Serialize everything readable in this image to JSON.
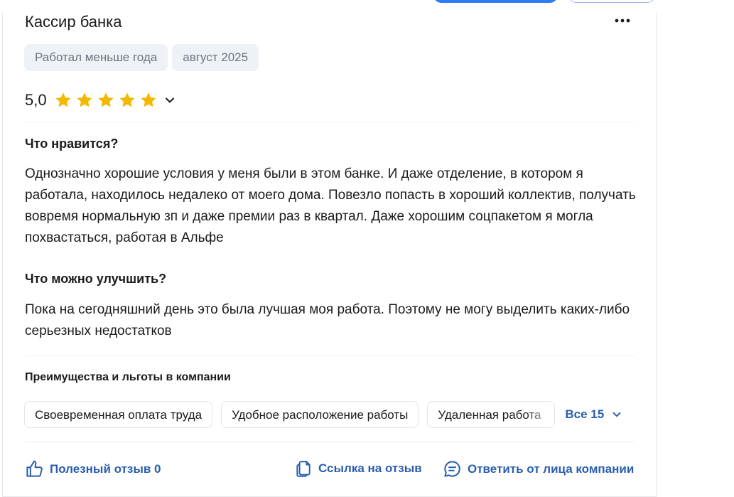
{
  "review": {
    "title": "Кассир банка",
    "tags": [
      "Работал меньше года",
      "август 2025"
    ],
    "rating": "5,0",
    "stars": 5,
    "likes_heading": "Что нравится?",
    "likes_text": "Однозначно хорошие условия у меня были в этом банке. И даже отделение, в котором я работала, находилось недалеко от моего дома. Повезло попасть в хороший коллектив, получать вовремя нормальную зп и даже премии раз в квартал. Даже хорошим соцпакетом я могла похвастаться, работая в Альфе",
    "improve_heading": "Что можно улучшить?",
    "improve_text": "Пока на сегодняшний день это была лучшая моя работа. Поэтому не могу выделить каких-либо серьезных недостатков"
  },
  "benefits": {
    "heading": "Преимущества и льготы в компании",
    "chips": [
      "Своевременная оплата труда",
      "Удобное расположение работы",
      "Удаленная работа"
    ],
    "all_label": "Все 15"
  },
  "footer": {
    "helpful_label": "Полезный отзыв 0",
    "link_label": "Ссылка на отзыв",
    "reply_label": "Ответить от лица компании"
  },
  "colors": {
    "accent": "#2a5db0",
    "star": "#f5b800",
    "tag_bg": "#eef1f6"
  },
  "icons": [
    "more-icon",
    "star-icon",
    "chevron-down-icon",
    "thumbs-up-icon",
    "copy-link-icon",
    "reply-chat-icon"
  ]
}
